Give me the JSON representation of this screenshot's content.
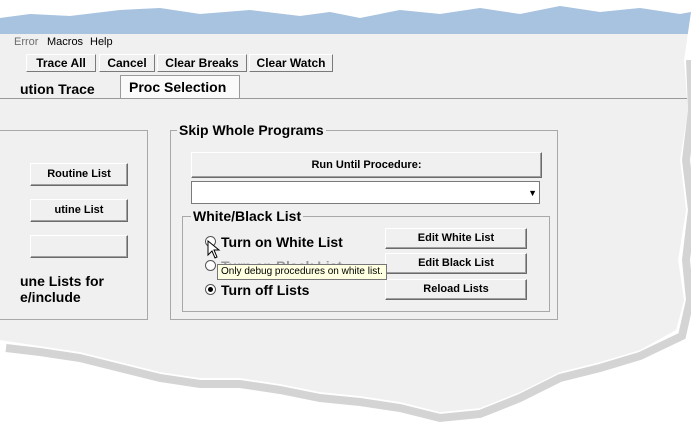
{
  "menu": {
    "items": [
      {
        "label": "Error",
        "disabled": true
      },
      {
        "label": "Macros",
        "disabled": false
      },
      {
        "label": "Help",
        "disabled": false
      }
    ]
  },
  "toolbar": {
    "buttons": [
      "Trace All",
      "Cancel",
      "Clear Breaks",
      "Clear Watch"
    ]
  },
  "tabs": {
    "trace": "ution Trace",
    "proc_selection": "Proc Selection"
  },
  "left_group": {
    "btn1": "Routine List",
    "btn2": "utine List",
    "btn3": "",
    "caption_line1": "une Lists for",
    "caption_line2": "e/include"
  },
  "skip_group": {
    "title": "Skip Whole Programs",
    "run_until_label": "Run Until Procedure:",
    "procedure_value": "",
    "wb_title": "White/Black List",
    "radios": {
      "white": "Turn on White List",
      "black": "Turn on Black List",
      "off": "Turn off Lists"
    },
    "buttons": {
      "edit_white": "Edit White List",
      "edit_black": "Edit Black List",
      "reload": "Reload Lists"
    },
    "selected": "off"
  },
  "tooltip": "Only debug procedures on white list."
}
